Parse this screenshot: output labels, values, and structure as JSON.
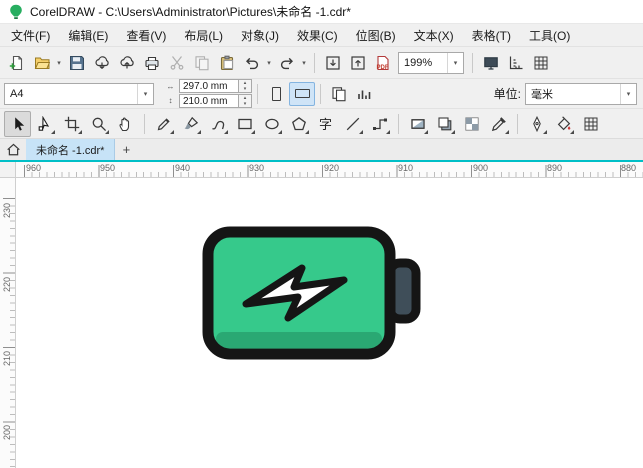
{
  "window": {
    "title": "CorelDRAW - C:\\Users\\Administrator\\Pictures\\未命名 -1.cdr*"
  },
  "menu": {
    "items": [
      "文件(F)",
      "编辑(E)",
      "查看(V)",
      "布局(L)",
      "对象(J)",
      "效果(C)",
      "位图(B)",
      "文本(X)",
      "表格(T)",
      "工具(O)"
    ]
  },
  "toolbar": {
    "zoom_level": "199%",
    "pdf_label": "PDF"
  },
  "property_bar": {
    "page_size": "A4",
    "width": "297.0 mm",
    "height": "210.0 mm",
    "units_label": "单位:",
    "units": "毫米"
  },
  "toolbox": {
    "text_tool": "字"
  },
  "tabs": {
    "active": "未命名 -1.cdr*",
    "add": "+"
  },
  "rulers": {
    "horizontal": [
      "960",
      "950",
      "940",
      "930",
      "920",
      "910",
      "900",
      "890",
      "880"
    ],
    "vertical": [
      "230",
      "220",
      "210",
      "200"
    ]
  },
  "glyphs": {
    "chevron_down": "▾",
    "spin_up": "▴",
    "spin_down": "▾",
    "width_arrow": "↔",
    "height_arrow": "↕"
  },
  "colors": {
    "battery_body": "#36c98b",
    "battery_shade": "#2aa873",
    "battery_terminal": "#3f4e59",
    "battery_outline": "#151515",
    "desktop_divider": "#00bfc7",
    "active_tab_bg": "#c7e3f7"
  }
}
